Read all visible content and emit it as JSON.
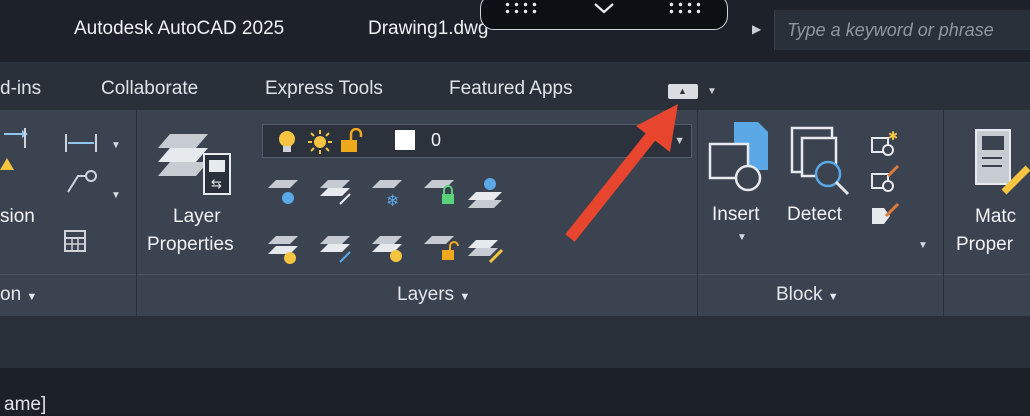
{
  "titlebar": {
    "app_name": "Autodesk AutoCAD 2025",
    "document": "Drawing1.dwg",
    "search_placeholder": "Type a keyword or phrase"
  },
  "tabs": [
    "d-ins",
    "Collaborate",
    "Express Tools",
    "Featured Apps"
  ],
  "ribbon": {
    "dimension_label": "sion",
    "annotation_footer": "on",
    "layer_properties_line1": "Layer",
    "layer_properties_line2": "Properties",
    "layer_current": "0",
    "layers_footer": "Layers",
    "insert_label": "Insert",
    "detect_label": "Detect",
    "block_footer": "Block",
    "match_line1": "Matc",
    "match_line2": "Proper"
  },
  "bottom": {
    "text": "ame]"
  },
  "colors": {
    "arrow": "#e8452f",
    "accent_blue": "#5aa9e6",
    "bulb": "#f5c542"
  }
}
